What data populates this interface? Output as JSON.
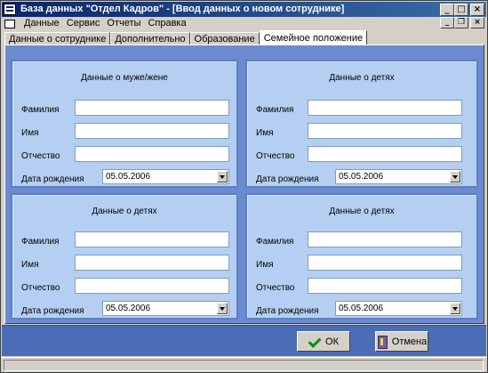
{
  "window": {
    "title": "База данных \"Отдел Кадров\" - [Ввод данных о новом сотруднике]",
    "min": "_",
    "max": "□",
    "close": "×",
    "mdi_min": "_",
    "mdi_restore": "❐",
    "mdi_close": "×"
  },
  "menu": [
    "Данные",
    "Сервис",
    "Отчеты",
    "Справка"
  ],
  "tabs": [
    "Данные о сотруднике",
    "Дополнительно",
    "Образование",
    "Семейное положение"
  ],
  "labels": {
    "surname": "Фамилия",
    "name": "Имя",
    "patronymic": "Отчество",
    "birthdate": "Дата рождения"
  },
  "groups": [
    {
      "title": "Данные о муже/жене",
      "date": "05.05.2006",
      "surname": "",
      "name": "",
      "patronymic": ""
    },
    {
      "title": "Данные о детях",
      "date": "05.05.2006",
      "surname": "",
      "name": "",
      "patronymic": ""
    },
    {
      "title": "Данные о детях",
      "date": "05.05.2006",
      "surname": "",
      "name": "",
      "patronymic": ""
    },
    {
      "title": "Данные о детях",
      "date": "05.05.2006",
      "surname": "",
      "name": "",
      "patronymic": ""
    }
  ],
  "buttons": {
    "ok": "ОК",
    "cancel": "Отмена"
  },
  "colors": {
    "panel": "#6b8bd0",
    "group": "#b5cff2",
    "title_bar": "#0a246a"
  }
}
